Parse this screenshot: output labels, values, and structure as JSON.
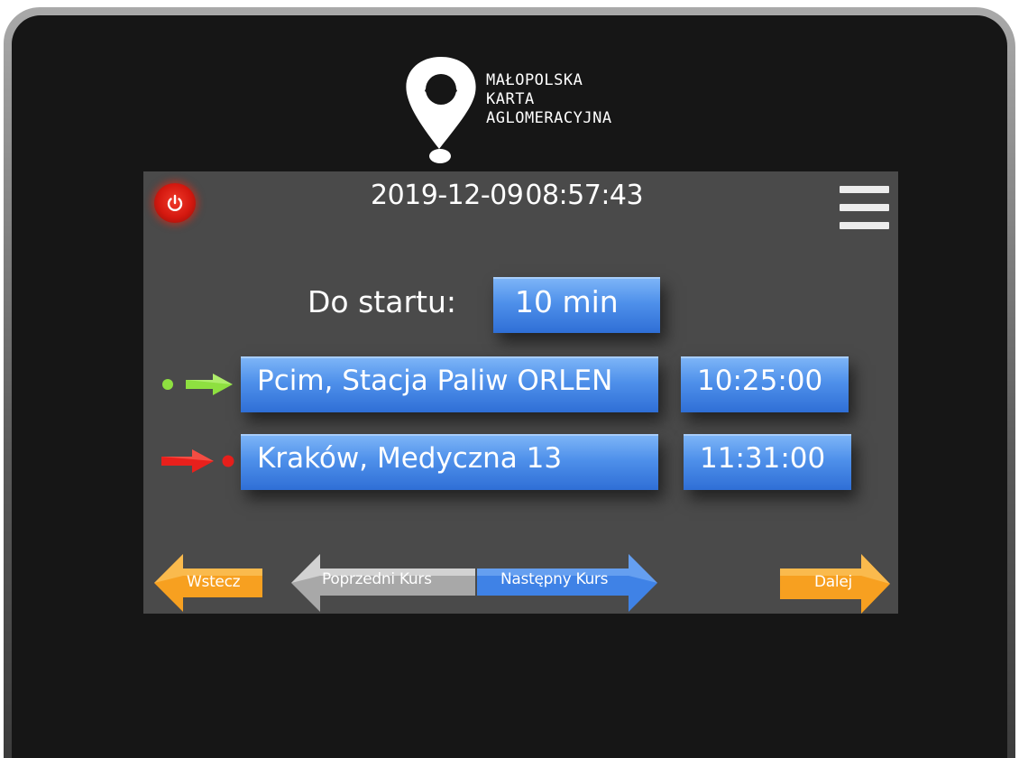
{
  "brand": {
    "line1": "MAŁOPOLSKA",
    "line2": "KARTA",
    "line3": "AGLOMERACYJNA"
  },
  "header": {
    "date": "2019-12-09",
    "time": "08:57:43"
  },
  "start": {
    "label": "Do startu:",
    "value": "10 min"
  },
  "stops": [
    {
      "name": "Pcim, Stacja Paliw ORLEN",
      "time": "10:25:00",
      "indicator": "green-arrow-icon"
    },
    {
      "name": "Kraków, Medyczna 13",
      "time": "11:31:00",
      "indicator": "red-arrow-icon"
    }
  ],
  "nav": {
    "back": "Wstecz",
    "prev_course": "Poprzedni Kurs",
    "next_course": "Następny Kurs",
    "next": "Dalej"
  },
  "colors": {
    "screen_bg": "#4a4a4a",
    "accent_blue": "#3f82e6",
    "orange": "#f7a020",
    "power_red": "#e02a1c",
    "green": "#8ee040",
    "red": "#e8201c"
  },
  "icons": {
    "power": "power-icon",
    "menu": "hamburger-menu-icon",
    "logo": "location-pin-logo-icon"
  }
}
